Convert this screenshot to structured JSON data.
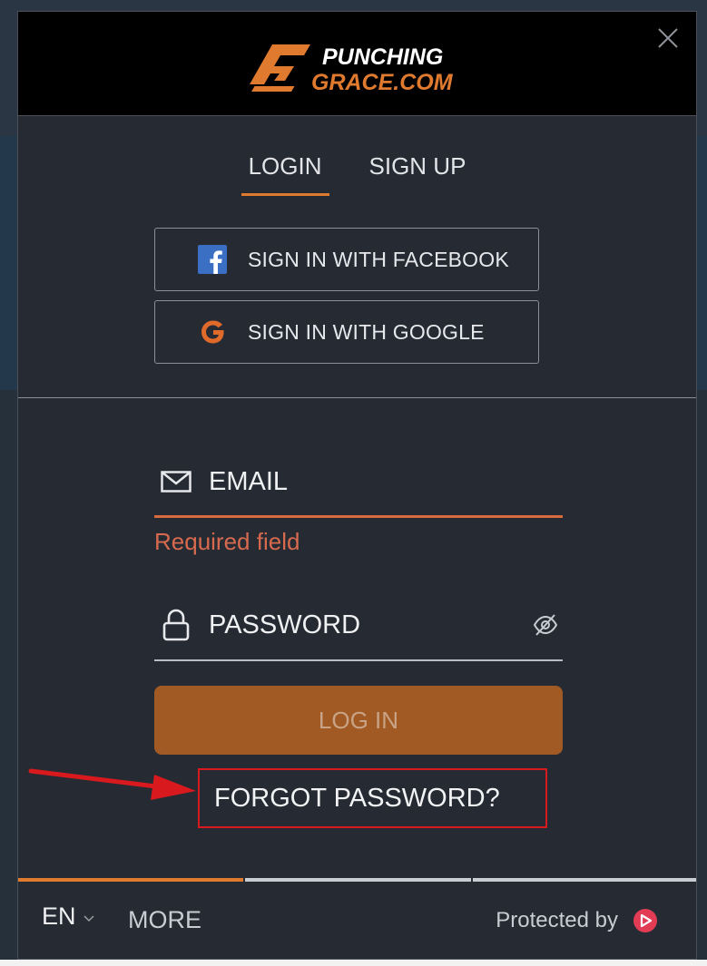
{
  "header": {
    "logo_line1": "PUNCHING",
    "logo_line2": "GRACE.COM"
  },
  "tabs": [
    {
      "label": "LOGIN",
      "active": true
    },
    {
      "label": "SIGN UP",
      "active": false
    }
  ],
  "social": {
    "facebook_label": "SIGN IN WITH FACEBOOK",
    "google_label": "SIGN IN WITH GOOGLE"
  },
  "form": {
    "email_placeholder": "EMAIL",
    "email_value": "",
    "email_error": "Required field",
    "password_placeholder": "PASSWORD",
    "password_value": "",
    "login_label": "LOG IN",
    "forgot_label": "FORGOT PASSWORD?"
  },
  "footer": {
    "lang": "EN",
    "more_label": "MORE",
    "protected_label": "Protected by"
  },
  "colors": {
    "accent": "#e07a2e",
    "error": "#d76a4e",
    "login_button": "#a25a24",
    "annotation_red": "#d8191d",
    "facebook_blue": "#3b6fc4",
    "google_orange": "#e06a2a",
    "protect_badge": "#e23c55"
  },
  "icons": {
    "close": "close-icon",
    "facebook": "facebook-icon",
    "google": "google-icon",
    "email": "envelope-icon",
    "password": "lock-icon",
    "visibility": "eye-slash-icon",
    "lang_dropdown": "chevron-down-icon",
    "protect_badge": "play-shield-icon"
  }
}
